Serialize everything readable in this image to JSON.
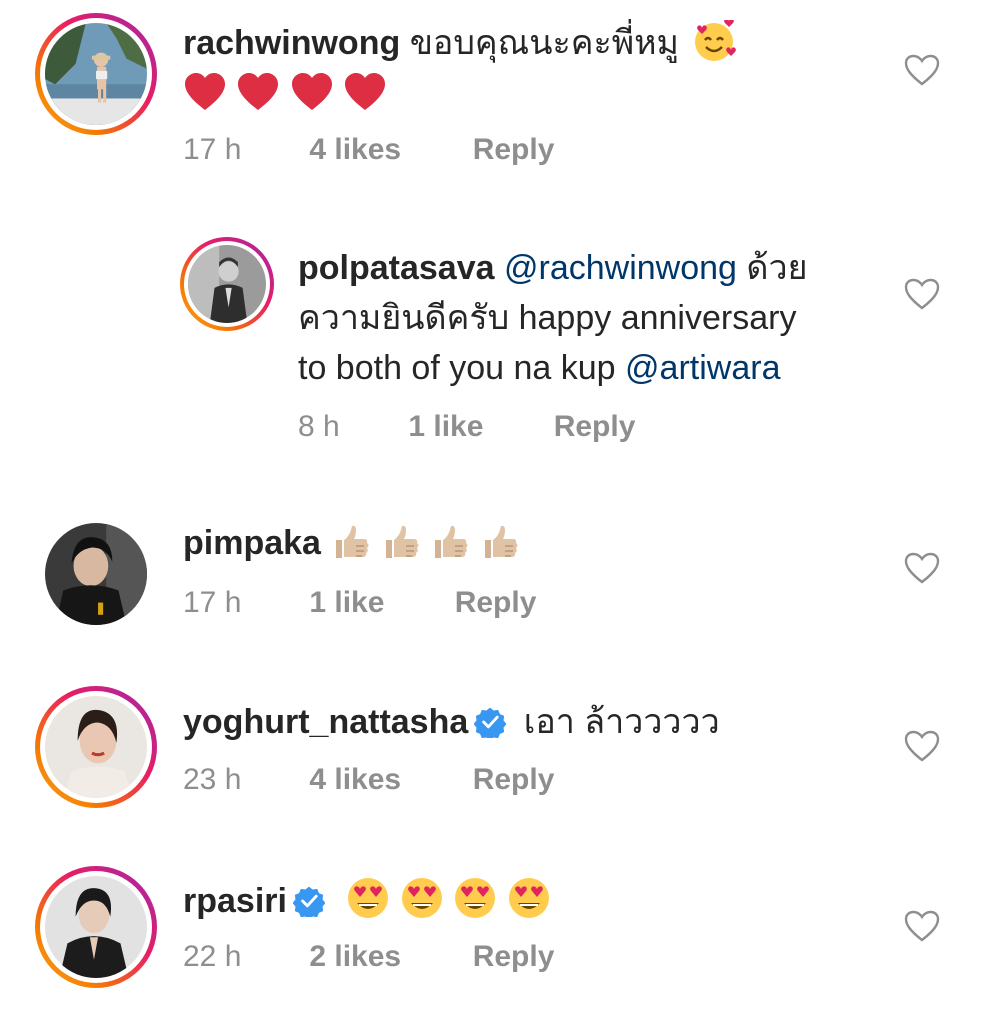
{
  "comments": [
    {
      "username": "rachwinwong",
      "text": "ขอบคุณนะคะพี่หมู",
      "emoji_after_text": "smiling-face-with-hearts",
      "second_line_emojis": [
        "red-heart",
        "red-heart",
        "red-heart",
        "red-heart"
      ],
      "time": "17 h",
      "likes": "4 likes",
      "reply": "Reply",
      "has_story_ring": true
    },
    {
      "username": "polpatasava",
      "mention1": "@rachwinwong",
      "text1": "ด้วย",
      "line2": "ความยินดีครับ happy anniversary",
      "line3_text": "to both of you na kup",
      "mention2": "@artiwara",
      "time": "8 h",
      "likes": "1 like",
      "reply": "Reply",
      "has_story_ring": true,
      "is_reply": true
    },
    {
      "username": "pimpaka",
      "emojis": [
        "thumbs-up",
        "thumbs-up",
        "thumbs-up",
        "thumbs-up"
      ],
      "time": "17 h",
      "likes": "1 like",
      "reply": "Reply",
      "has_story_ring": false
    },
    {
      "username": "yoghurt_nattasha",
      "verified": true,
      "text": "เอา ล้าววววว",
      "time": "23 h",
      "likes": "4 likes",
      "reply": "Reply",
      "has_story_ring": true
    },
    {
      "username": "rpasiri",
      "verified": true,
      "emojis": [
        "heart-eyes",
        "heart-eyes",
        "heart-eyes",
        "heart-eyes"
      ],
      "time": "22 h",
      "likes": "2 likes",
      "reply": "Reply",
      "has_story_ring": true
    }
  ],
  "colors": {
    "text": "#262626",
    "meta": "#8e8e8e",
    "mention": "#00376b",
    "verified": "#3897f0",
    "heart_outline": "#8e8e8e"
  }
}
